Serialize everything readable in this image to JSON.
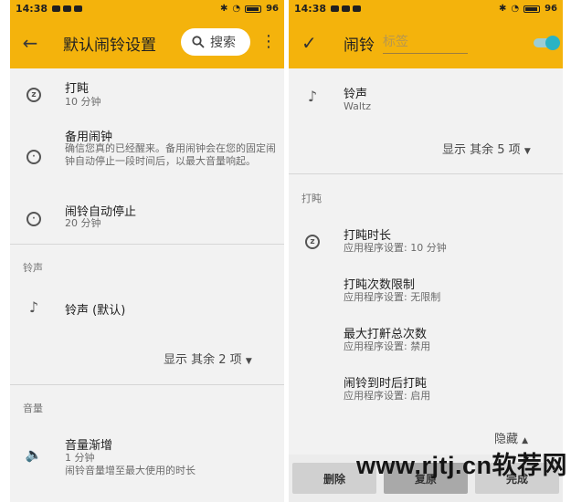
{
  "status": {
    "time": "14:38",
    "battery": "96"
  },
  "left": {
    "toolbar": {
      "back_icon": "←",
      "title": "默认闹铃设置",
      "search_label": "搜索",
      "more_icon": "⋮"
    },
    "rows": [
      {
        "title": "打盹",
        "subtitle": "10 分钟"
      },
      {
        "title": "备用闹钟",
        "subtitle": "确信您真的已经醒来。备用闹钟会在您的固定闹钟自动停止一段时间后，以最大音量响起。"
      },
      {
        "title": "闹铃自动停止",
        "subtitle": "20 分钟"
      }
    ],
    "section_ringtone": "铃声",
    "ringtone_title": "铃声 (默认)",
    "show_more": "显示 其余 2 项",
    "section_volume": "音量",
    "volume_title": "音量渐增",
    "volume_sub1": "1 分钟",
    "volume_sub2": "闹铃音量增至最大使用的时长"
  },
  "right": {
    "toolbar": {
      "check_icon": "✓",
      "title": "闹铃",
      "label_placeholder": "标签",
      "toggle_on": true
    },
    "ringtone_title": "铃声",
    "ringtone_value": "Waltz",
    "show_more": "显示 其余 5 项",
    "section_snooze": "打盹",
    "rows": [
      {
        "title": "打盹时长",
        "subtitle": "应用程序设置: 10 分钟"
      },
      {
        "title": "打盹次数限制",
        "subtitle": "应用程序设置: 无限制"
      },
      {
        "title": "最大打鼾总次数",
        "subtitle": "应用程序设置: 禁用"
      },
      {
        "title": "闹铃到时后打盹",
        "subtitle": "应用程序设置: 启用"
      }
    ],
    "hide_label": "隐藏",
    "buttons": {
      "delete": "删除",
      "revert": "复原",
      "done": "完成"
    }
  },
  "watermark": "www.rjtj.cn软荐网",
  "colors": {
    "accent": "#f4b30c",
    "toggle": "#2ab3c5"
  }
}
